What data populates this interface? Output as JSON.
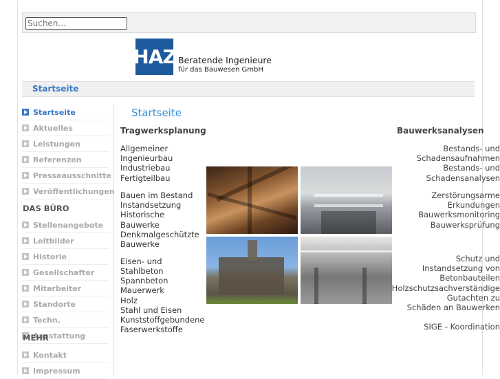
{
  "search": {
    "placeholder": "Suchen..."
  },
  "logo": {
    "abbr": "HAZ",
    "line1": "Beratende Ingenieure",
    "line2": "für das Bauwesen GmbH"
  },
  "breadcrumb": "Startseite",
  "sidebar": {
    "items": [
      {
        "label": "Startseite",
        "active": true
      },
      {
        "label": "Aktuelles"
      },
      {
        "label": "Leistungen"
      },
      {
        "label": "Referenzen"
      },
      {
        "label": "Presseausschnitte"
      },
      {
        "label": "Veröffentlichungen"
      }
    ],
    "heading1": "DAS BÜRO",
    "items2": [
      {
        "label": "Stellenangebote"
      },
      {
        "label": "Leitbilder"
      },
      {
        "label": "Historie"
      },
      {
        "label": "Gesellschafter"
      },
      {
        "label": "Mitarbeiter"
      },
      {
        "label": "Standorte"
      },
      {
        "label": "Techn."
      },
      {
        "label": "Ausstattung"
      }
    ],
    "heading2": "MEHR",
    "items3": [
      {
        "label": "Kontakt"
      },
      {
        "label": "Impressum"
      }
    ]
  },
  "main": {
    "title": "Startseite",
    "left_title": "Tragwerksplanung",
    "left_lines": [
      "Allgemeiner",
      "Ingenieurbau",
      "Industriebau",
      "Fertigteilbau",
      "Bauen im Bestand",
      "Instandsetzung",
      "Historische",
      "Bauwerke",
      "Denkmalgeschützte",
      "Bauwerke",
      "Eisen- und",
      "Stahlbeton",
      "Spannbeton",
      "Mauerwerk",
      "Holz",
      "Stahl und Eisen",
      "Kunststoffgebundene",
      "Faserwerkstoffe"
    ],
    "right_title": "Bauwerksanalysen",
    "right_lines": [
      "Bestands- und",
      "Schadensaufnahmen",
      "Bestands- und",
      "Schadensanalysen",
      "Zerstörungsarme",
      "Erkundungen",
      "Bauwerksmonitoring",
      "Bauwerksprüfung",
      "Schutz und",
      "Instandsetzung von",
      "Betonbauteilen",
      "Holzschutzsachverständige",
      "Gutachten zu",
      "Schäden an Bauwerken",
      "SIGE - Koordination"
    ]
  }
}
